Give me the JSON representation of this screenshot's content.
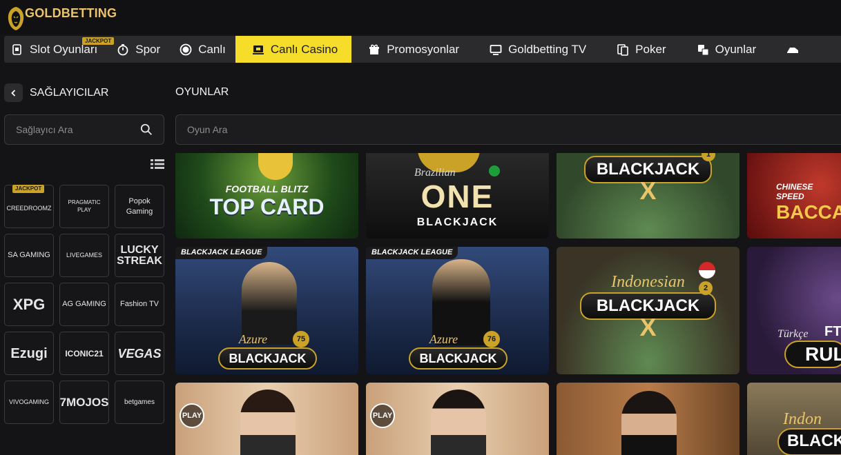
{
  "brand": {
    "name": "GOLDBETTING"
  },
  "nav": {
    "items": [
      {
        "label": "Slot Oyunları",
        "icon": "slot-icon",
        "badge": "JACKPOT"
      },
      {
        "label": "Spor",
        "icon": "stopwatch-icon"
      },
      {
        "label": "Canlı",
        "icon": "live-icon"
      },
      {
        "label": "Canlı Casino",
        "icon": "live-casino-icon",
        "active": true
      },
      {
        "label": "Promosyonlar",
        "icon": "gift-icon"
      },
      {
        "label": "Goldbetting TV",
        "icon": "tv-icon"
      },
      {
        "label": "Poker",
        "icon": "poker-icon"
      },
      {
        "label": "Oyunlar",
        "icon": "dice-icon"
      }
    ],
    "active_color": "#f6dd2a"
  },
  "sidebar": {
    "title": "SAĞLAYICILAR",
    "search_placeholder": "Sağlayıcı Ara",
    "providers": [
      {
        "label": "CREEDROOMZ",
        "badge": "JACKPOT"
      },
      {
        "label": "PRAGMATIC PLAY"
      },
      {
        "label": "Popok Gaming"
      },
      {
        "label": "SA GAMING"
      },
      {
        "label": "LIVEGAMES"
      },
      {
        "label": "LUCKY STREAK"
      },
      {
        "label": "XPG"
      },
      {
        "label": "AG GAMING"
      },
      {
        "label": "Fashion TV"
      },
      {
        "label": "Ezugi"
      },
      {
        "label": "ICONIC21"
      },
      {
        "label": "VEGAS"
      },
      {
        "label": "VIVOGAMING"
      },
      {
        "label": "7MOJOS"
      },
      {
        "label": "betgames"
      }
    ]
  },
  "games": {
    "title": "OYUNLAR",
    "search_placeholder": "Oyun Ara",
    "tiles": [
      {
        "line1": "FOOTBALL BLITZ",
        "line2": "TOP CARD"
      },
      {
        "line1": "Brazilian",
        "line2": "ONE",
        "line3": "BLACKJACK"
      },
      {
        "line1": "BLACKJACK",
        "line2": "X",
        "badge": "1"
      },
      {
        "line1": "CHINESE SPEED",
        "line2": "BACCA"
      },
      {
        "league": "BLACKJACK LEAGUE",
        "line1": "Azure",
        "line2": "BLACKJACK",
        "badge": "75"
      },
      {
        "league": "BLACKJACK LEAGUE",
        "line1": "Azure",
        "line2": "BLACKJACK",
        "badge": "76"
      },
      {
        "line1": "Indonesian",
        "line2": "BLACKJACK",
        "line3": "X",
        "badge": "2"
      },
      {
        "line1": "Türkçe",
        "line2": "RUL",
        "line3": "FT"
      },
      {
        "play": "PLAY"
      },
      {
        "play": "PLAY"
      },
      {
        "line1": ""
      },
      {
        "line1": "Indon",
        "line2": "BLACK"
      }
    ]
  }
}
